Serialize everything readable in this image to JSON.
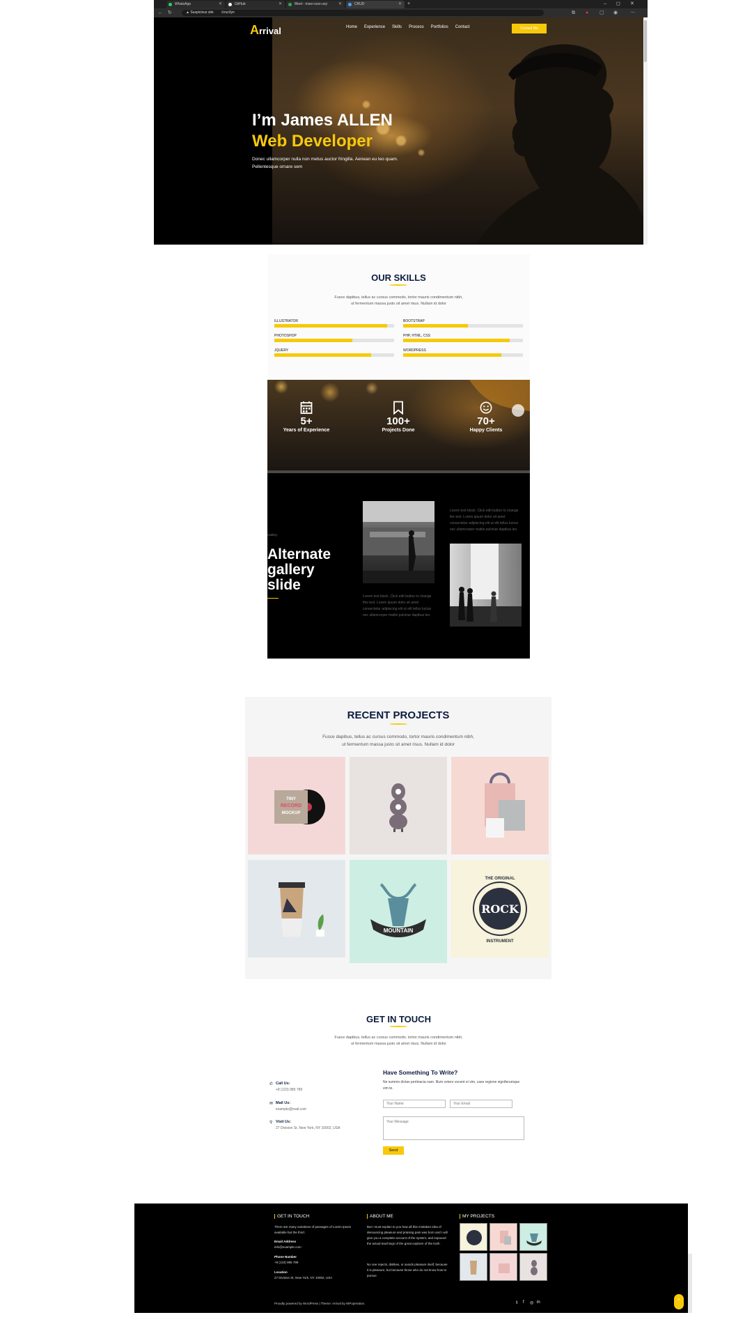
{
  "browser": {
    "tabs": [
      {
        "label": "WhatsApp",
        "color": "#25d366"
      },
      {
        "label": "GitHub",
        "color": "#ffffff"
      },
      {
        "label": "Meet - msw-cssx-uey",
        "color": "#34a853"
      },
      {
        "label": "CRUD",
        "color": "#4aa3ff"
      }
    ],
    "new_tab": "+",
    "address_security": "Suspicious site",
    "address_url": "/cruc/lyn",
    "window_controls": [
      "–",
      "◻",
      "✕"
    ]
  },
  "nav": {
    "logo_letter": "A",
    "logo_rest": "rrival",
    "items": [
      "Home",
      "Experience",
      "Skills",
      "Process",
      "Portfolios",
      "Contact"
    ],
    "contact_button": "Contact Me"
  },
  "hero": {
    "name": "I’m James ALLEN",
    "role": "Web Developer",
    "text": "Donec ullamcorper nulla non metus auctor fringilla. Aenean eu leo quam. Pellentesque ornare sem"
  },
  "skills": {
    "title": "OUR SKILLS",
    "subtitle_1": "Fusce dapibus, tellus ac cursus commodo, tortor mauris condimentum nibh,",
    "subtitle_2": "ut fermentum massa justo sit amet risus. Nullam id dolor",
    "items": [
      {
        "label": "ILLUSTRATOR",
        "level": 0.94
      },
      {
        "label": "BOOTSTRAP",
        "level": 0.54
      },
      {
        "label": "PHOTOSHOP",
        "level": 0.65
      },
      {
        "label": "PHP, HTML, CSS",
        "level": 0.89
      },
      {
        "label": "JQUERY",
        "level": 0.81
      },
      {
        "label": "WORDPRESS",
        "level": 0.82
      }
    ]
  },
  "counters": [
    {
      "number": "5+",
      "caption": "Years of Experience",
      "icon": "calendar-icon"
    },
    {
      "number": "100+",
      "caption": "Projects Done",
      "icon": "bookmark-icon"
    },
    {
      "number": "70+",
      "caption": "Happy Clients",
      "icon": "smiley-icon"
    }
  ],
  "gallery": {
    "tag": "Gallery",
    "title": "Alternate gallery slide",
    "text_top": "Lorem text block. Click edit button to change the text. Lorem ipsum dolor sit amet consectetur adipiscing elit ut elit tellus luctus nec ullamcorper mattis pulvinar dapibus leo.",
    "text_bottom": "Lorem text block. Click edit button to change this text. Lorem ipsum dolor sit amet consectetur adipiscing elit ut elit tellus luctus nec ullamcorper mattis pulvinar dapibus leo."
  },
  "projects": {
    "title": "RECENT PROJECTS",
    "subtitle_1": "Fusce dapibus, tellus ac cursus commodo, tortor mauris condimentum nibh,",
    "subtitle_2": "ut fermentum massa justo sit amet risus. Nullam id dolor",
    "tile_labels": {
      "record_1": "TINY",
      "record_2": "RECORD",
      "record_3": "MOCKUP",
      "mountain": "MOUNTAIN",
      "rock": "ROCK",
      "rock_arc_top": "THE ORIGINAL",
      "rock_arc_bottom": "INSTRUMENT"
    }
  },
  "contact": {
    "title": "GET IN TOUCH",
    "subtitle_1": "Fusce dapibus, tellus ac cursus commodo, tortor mauris condimentum nibh,",
    "subtitle_2": "ut fermentum massa justo sit amet risus. Nullam id dolor",
    "info": [
      {
        "title": "Call Us:",
        "value": "+8 (123) 985 789",
        "icon": "phone-icon"
      },
      {
        "title": "Mail Us:",
        "value": "example@mail.com",
        "icon": "mail-icon"
      },
      {
        "title": "Visit Us:",
        "value": "27 Division St, New York, NY 10002, USA",
        "icon": "location-icon"
      }
    ],
    "form_title": "Have Something To Write?",
    "form_text": "Ne summo dictas pertinacia nam. Illum cetero vocent ei vim, case regione signiferumque vim te.",
    "name_placeholder": "Your Name",
    "email_placeholder": "Your Email",
    "message_placeholder": "Your Message",
    "send": "Send"
  },
  "footer": {
    "col1_title": "GET IN TOUCH",
    "col1_text": "There are many variations of passages of Lorem Ipsum available but the third.",
    "email_label": "Email Address",
    "email_value": "info@example.com",
    "phone_label": "Phone Number",
    "phone_value": "+8 (123) 985 789",
    "location_label": "Location",
    "location_value": "27 Division St, New York, NY 10002, USA",
    "col2_title": "ABOUT ME",
    "col2_text_1": "But I must explain to you how all this mistaken idea of denouncing pleasure and praising pain was born and I will give you a complete account of the system, and expound the actual teachings of the great explorer of the truth.",
    "col2_text_2": "No one rejects, dislikes, or avoids pleasure itself, because it is pleasure, but because those who do not know how to pursue",
    "col3_title": "MY PROJECTS",
    "copyright": "Proudly powered by WordPress | Theme: Arrival by WPoperation.",
    "social": [
      "twitter-icon",
      "facebook-icon",
      "instagram-icon",
      "linkedin-icon"
    ],
    "to_top": "⌃"
  },
  "colors": {
    "accent": "#f7c90a",
    "navy": "#0d1b3e"
  }
}
